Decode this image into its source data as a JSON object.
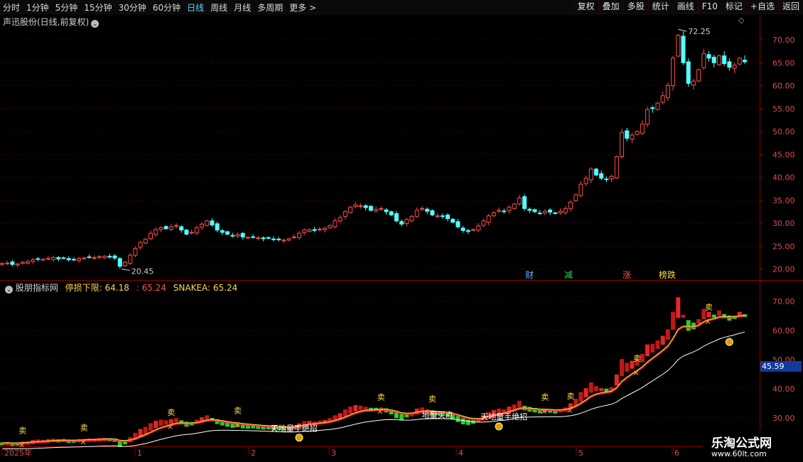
{
  "toolbar": {
    "left": [
      "分时",
      "1分钟",
      "5分钟",
      "15分钟",
      "30分钟",
      "60分钟",
      "日线",
      "周线",
      "月线",
      "多周期",
      "更多 >"
    ],
    "active": "日线",
    "right": [
      "复权",
      "叠加",
      "多股",
      "统计",
      "画线",
      "F10",
      "标记",
      "+自选",
      "返回"
    ]
  },
  "main_panel": {
    "title": "声迅股份(日线,前复权)",
    "y_ticks": [
      "70.00",
      "65.00",
      "60.00",
      "55.00",
      "50.00",
      "45.00",
      "40.00",
      "35.00",
      "30.00",
      "25.00",
      "20.00"
    ],
    "high_label": "72.25",
    "low_label": "20.45",
    "markers": [
      {
        "text": "财",
        "color": "#5fb0ff"
      },
      {
        "text": "减",
        "color": "#2fd36f"
      },
      {
        "text": "涨",
        "color": "#ff5050"
      },
      {
        "text": "榜跌",
        "color": "#ffd84a"
      }
    ]
  },
  "indicator_panel": {
    "name": "股朋指标网",
    "stop_label": "停损下限: 64.18",
    "value2": ": 65.24",
    "snake_label": "SNAKEA: 65.24",
    "y_ticks": [
      "70.00",
      "60.00",
      "50.00",
      "40.00",
      "30.00"
    ],
    "current_price": "45.59",
    "signal_texts": [
      "卖",
      "天地量手绝招",
      "地量买点"
    ]
  },
  "x_axis": {
    "labels": [
      "2025年",
      "1",
      "2",
      "3",
      "4",
      "5",
      "6"
    ]
  },
  "watermark": {
    "line1": "乐淘公式网",
    "line2": "www.60lt.com"
  },
  "colors": {
    "up": "#ff4b4b",
    "down": "#54ffff",
    "grid": "#5a0000",
    "snake": "#ffd84a"
  },
  "chart_data": {
    "type": "candlestick",
    "title": "声迅股份(日线,前复权)",
    "ylim": [
      18,
      75
    ],
    "closes": [
      21.2,
      21.3,
      21.0,
      21.1,
      21.5,
      21.6,
      22.0,
      22.2,
      22.1,
      22.3,
      22.5,
      22.2,
      22.4,
      22.0,
      22.1,
      22.3,
      22.4,
      22.6,
      22.5,
      22.7,
      22.8,
      22.6,
      22.4,
      20.6,
      21.5,
      23.0,
      24.5,
      25.8,
      26.5,
      27.8,
      28.6,
      29.0,
      28.8,
      29.2,
      29.5,
      28.5,
      27.6,
      28.0,
      29.0,
      29.8,
      30.5,
      29.6,
      28.5,
      28.0,
      27.6,
      27.2,
      27.5,
      27.0,
      26.9,
      27.0,
      26.8,
      26.6,
      26.7,
      26.4,
      26.5,
      26.3,
      26.6,
      27.0,
      27.8,
      28.5,
      28.6,
      28.4,
      28.7,
      28.9,
      29.5,
      30.5,
      31.2,
      32.5,
      33.5,
      34.0,
      33.8,
      33.4,
      32.8,
      33.0,
      33.2,
      32.5,
      31.8,
      30.5,
      29.8,
      30.8,
      31.5,
      32.8,
      33.2,
      32.6,
      31.8,
      31.6,
      31.5,
      31.0,
      30.2,
      29.2,
      28.4,
      28.2,
      28.6,
      29.4,
      30.5,
      31.6,
      32.3,
      32.8,
      32.6,
      33.5,
      34.2,
      35.5,
      33.2,
      32.8,
      32.5,
      32.2,
      32.6,
      32.4,
      32.1,
      32.6,
      33.2,
      34.6,
      36.2,
      38.5,
      39.8,
      41.8,
      40.5,
      39.8,
      39.5,
      40.2,
      44.5,
      49.8,
      48.5,
      49.2,
      50.0,
      51.6,
      54.8,
      55.0,
      56.2,
      57.8,
      60.0,
      66.0,
      71.0,
      65.0,
      60.5,
      61.0,
      63.5,
      67.0,
      66.0,
      65.0,
      66.5,
      64.8,
      64.0,
      64.5,
      66.0,
      65.2
    ]
  }
}
